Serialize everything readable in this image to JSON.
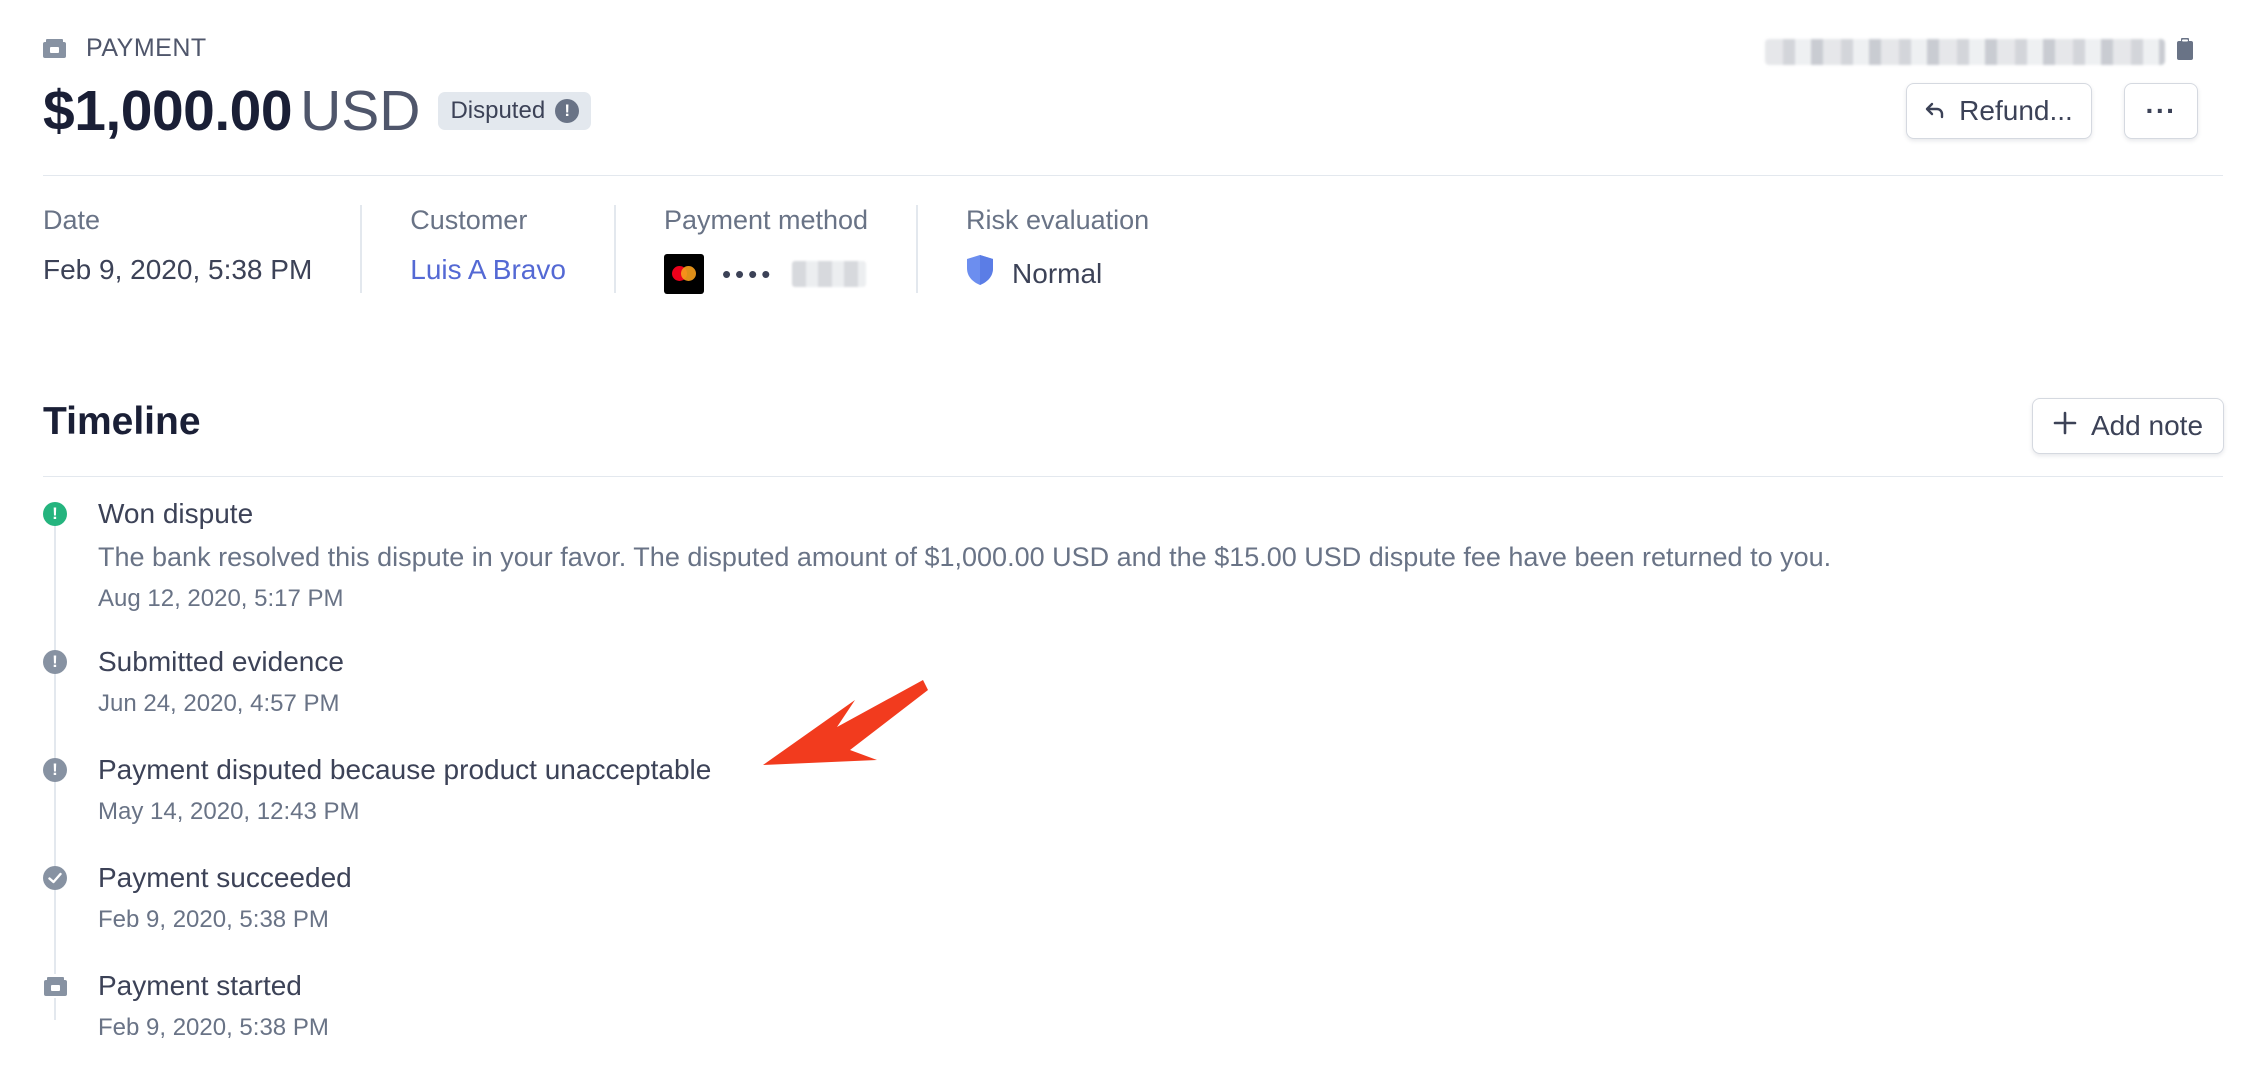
{
  "header": {
    "eyebrow_label": "PAYMENT",
    "amount": "$1,000.00",
    "currency": "USD",
    "status_badge": "Disputed",
    "status_badge_icon": "!",
    "refund_button": "Refund...",
    "more_button": "···",
    "copy_icon": "clipboard-icon"
  },
  "summary": {
    "date": {
      "label": "Date",
      "value": "Feb 9, 2020, 5:38 PM"
    },
    "customer": {
      "label": "Customer",
      "value": "Luis A Bravo"
    },
    "payment_method": {
      "label": "Payment method",
      "dots": "••••",
      "brand_icon": "mastercard-icon"
    },
    "risk": {
      "label": "Risk evaluation",
      "value": "Normal",
      "icon": "shield-icon"
    }
  },
  "timeline": {
    "title": "Timeline",
    "add_note_button": "Add note",
    "items": [
      {
        "title": "Won dispute",
        "description": "The bank resolved this dispute in your favor. The disputed amount of $1,000.00 USD and the $15.00 USD dispute fee have been returned to you.",
        "time": "Aug 12, 2020, 5:17 PM",
        "icon": "alert-icon",
        "icon_color": "#24b47e"
      },
      {
        "title": "Submitted evidence",
        "time": "Jun 24, 2020, 4:57 PM",
        "icon": "alert-icon",
        "icon_color": "#8792a2"
      },
      {
        "title": "Payment disputed because product unacceptable",
        "time": "May 14, 2020, 12:43 PM",
        "icon": "alert-icon",
        "icon_color": "#8792a2"
      },
      {
        "title": "Payment succeeded",
        "time": "Feb 9, 2020, 5:38 PM",
        "icon": "check-icon",
        "icon_color": "#8792a2"
      },
      {
        "title": "Payment started",
        "time": "Feb 9, 2020, 5:38 PM",
        "icon": "payment-icon",
        "icon_color": "#8792a2"
      }
    ]
  },
  "annotation": {
    "arrow_color": "#f23b1e"
  }
}
